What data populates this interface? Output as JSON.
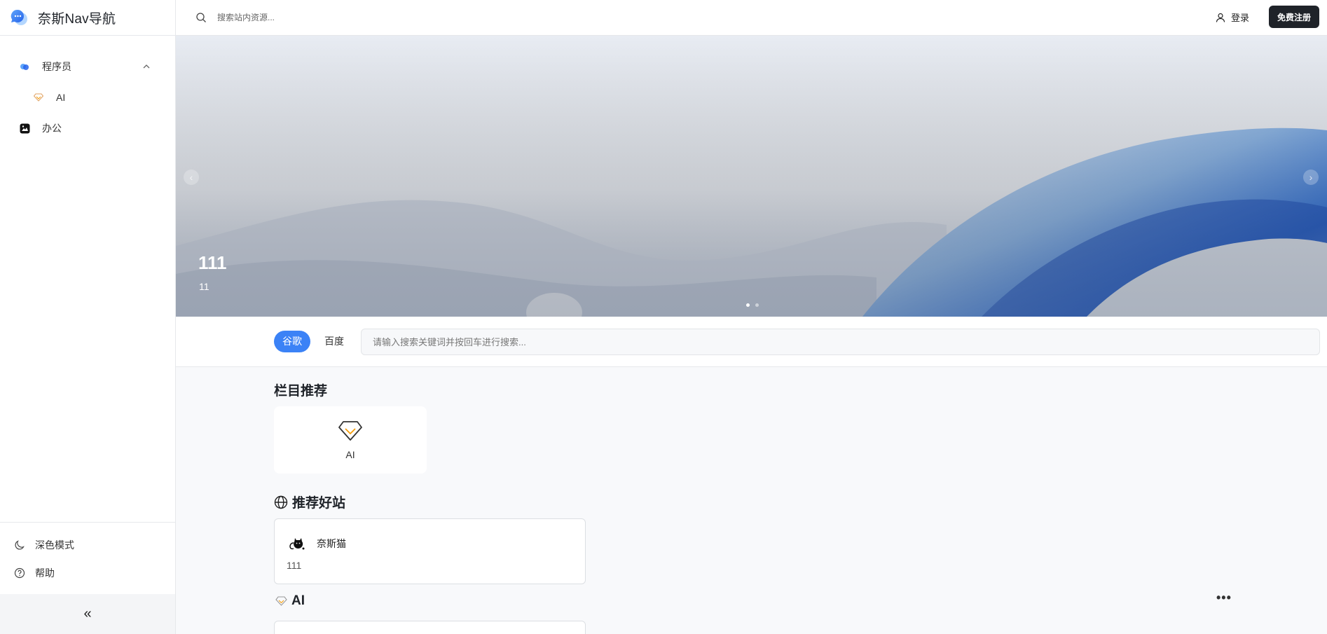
{
  "brand": {
    "name": "奈斯Nav导航",
    "logo_icon": "chat-bubble-icon",
    "accent": "#3b82f6"
  },
  "sidebar": {
    "items": [
      {
        "label": "程序员",
        "icon": "cloud-icon",
        "expanded": true
      },
      {
        "label": "AI",
        "icon": "diamond-icon",
        "level": 2
      },
      {
        "label": "办公",
        "icon": "image-icon"
      }
    ],
    "bottom": [
      {
        "label": "深色模式",
        "icon": "moon-icon"
      },
      {
        "label": "帮助",
        "icon": "help-circle-icon"
      }
    ],
    "collapse_label": "«"
  },
  "topbar": {
    "search_placeholder": "搜索站内资源...",
    "login_label": "登录",
    "register_label": "免费注册"
  },
  "banner": {
    "title": "111",
    "subtitle": "11",
    "slide_count": 2,
    "active_slide": 1
  },
  "engines": {
    "tabs": [
      "谷歌",
      "百度"
    ],
    "active": "谷歌",
    "placeholder": "请输入搜索关键词并按回车进行搜索..."
  },
  "sections": {
    "recommended_columns": {
      "title": "栏目推荐",
      "items": [
        {
          "label": "AI",
          "icon": "diamond-icon"
        }
      ]
    },
    "recommended_sites": {
      "title": "推荐好站",
      "icon": "globe-icon",
      "items": [
        {
          "name": "奈斯猫",
          "desc": "111",
          "icon": "cat-logo-icon"
        }
      ]
    },
    "ai": {
      "title": "AI",
      "icon": "diamond-icon",
      "more_label": "•••"
    }
  }
}
